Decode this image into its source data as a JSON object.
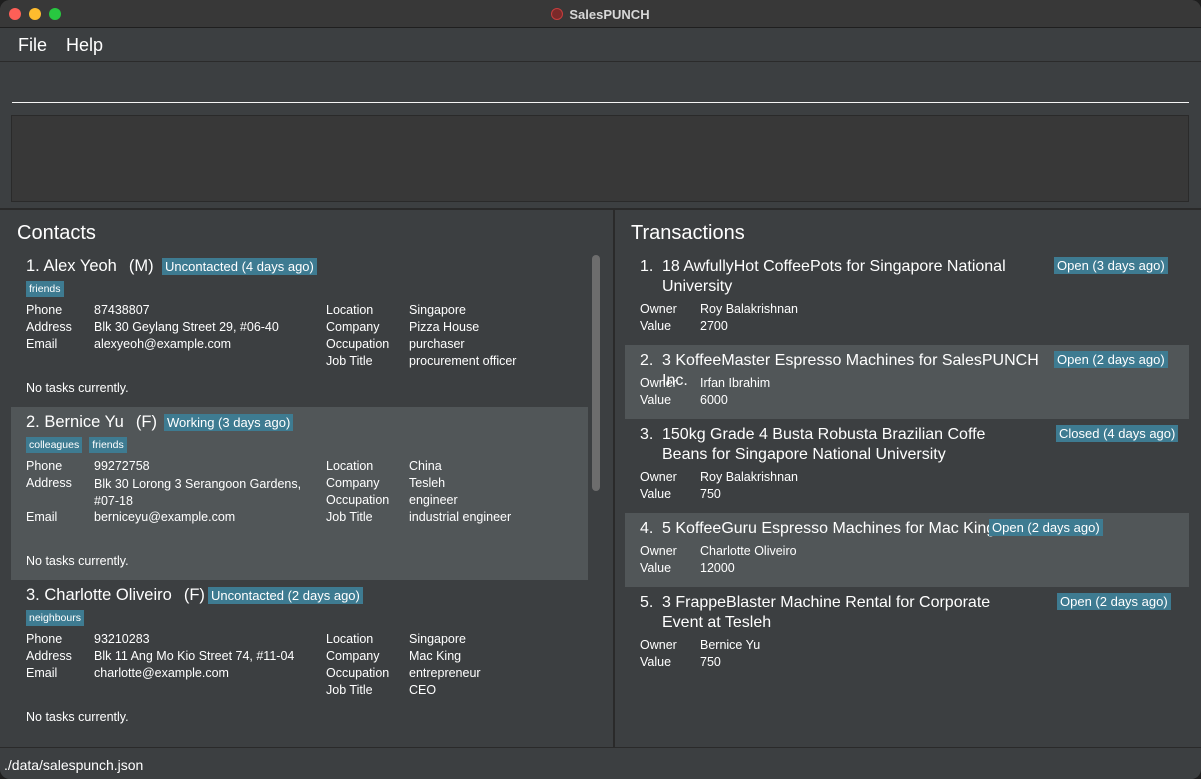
{
  "window": {
    "title": "SalesPUNCH"
  },
  "menu": {
    "file": "File",
    "help": "Help"
  },
  "command": {
    "value": ""
  },
  "result": {
    "text": ""
  },
  "contacts": {
    "title": "Contacts",
    "items": [
      {
        "index": "1.",
        "name": "Alex Yeoh",
        "gender": "(M)",
        "status": "Uncontacted (4 days ago)",
        "tags": [
          "friends"
        ],
        "phone_label": "Phone",
        "phone": "87438807",
        "address_label": "Address",
        "address": "Blk 30 Geylang Street 29, #06-40",
        "email_label": "Email",
        "email": "alexyeoh@example.com",
        "location_label": "Location",
        "location": "Singapore",
        "company_label": "Company",
        "company": "Pizza House",
        "occupation_label": "Occupation",
        "occupation": "purchaser",
        "jobtitle_label": "Job Title",
        "jobtitle": "procurement officer",
        "tasks": "No tasks currently."
      },
      {
        "index": "2.",
        "name": "Bernice Yu",
        "gender": "(F)",
        "status": "Working (3 days ago)",
        "tags": [
          "colleagues",
          "friends"
        ],
        "phone_label": "Phone",
        "phone": "99272758",
        "address_label": "Address",
        "address": "Blk 30 Lorong 3 Serangoon Gardens, #07-18",
        "email_label": "Email",
        "email": "berniceyu@example.com",
        "location_label": "Location",
        "location": "China",
        "company_label": "Company",
        "company": "Tesleh",
        "occupation_label": "Occupation",
        "occupation": "engineer",
        "jobtitle_label": "Job Title",
        "jobtitle": "industrial engineer",
        "tasks": "No tasks currently."
      },
      {
        "index": "3.",
        "name": "Charlotte Oliveiro",
        "gender": "(F)",
        "status": "Uncontacted (2 days ago)",
        "tags": [
          "neighbours"
        ],
        "phone_label": "Phone",
        "phone": "93210283",
        "address_label": "Address",
        "address": "Blk 11 Ang Mo Kio Street 74, #11-04",
        "email_label": "Email",
        "email": "charlotte@example.com",
        "location_label": "Location",
        "location": "Singapore",
        "company_label": "Company",
        "company": "Mac King",
        "occupation_label": "Occupation",
        "occupation": "entrepreneur",
        "jobtitle_label": "Job Title",
        "jobtitle": "CEO",
        "tasks": "No tasks currently."
      }
    ]
  },
  "transactions": {
    "title": "Transactions",
    "items": [
      {
        "index": "1.",
        "title": "18 AwfullyHot CoffeePots for Singapore National University",
        "status": "Open (3 days ago)",
        "owner_label": "Owner",
        "owner": "Roy Balakrishnan",
        "value_label": "Value",
        "value": "2700"
      },
      {
        "index": "2.",
        "title": "3 KoffeeMaster Espresso Machines for SalesPUNCH Inc.",
        "status": "Open (2 days ago)",
        "owner_label": "Owner",
        "owner": "Irfan Ibrahim",
        "value_label": "Value",
        "value": "6000"
      },
      {
        "index": "3.",
        "title": "150kg Grade 4 Busta Robusta Brazilian Coffe Beans for Singapore National University",
        "status": "Closed (4 days ago)",
        "owner_label": "Owner",
        "owner": "Roy Balakrishnan",
        "value_label": "Value",
        "value": "750"
      },
      {
        "index": "4.",
        "title": "5 KoffeeGuru Espresso Machines for Mac King",
        "status": "Open (2 days ago)",
        "owner_label": "Owner",
        "owner": "Charlotte Oliveiro",
        "value_label": "Value",
        "value": "12000"
      },
      {
        "index": "5.",
        "title": "3 FrappeBlaster Machine Rental for Corporate Event at Tesleh",
        "status": "Open (2 days ago)",
        "owner_label": "Owner",
        "owner": "Bernice Yu",
        "value_label": "Value",
        "value": "750"
      }
    ]
  },
  "statusbar": {
    "path": "./data/salespunch.json"
  },
  "colors": {
    "accent": "#3e7b91",
    "background": "#3c3f41",
    "card_alt": "#515658"
  }
}
